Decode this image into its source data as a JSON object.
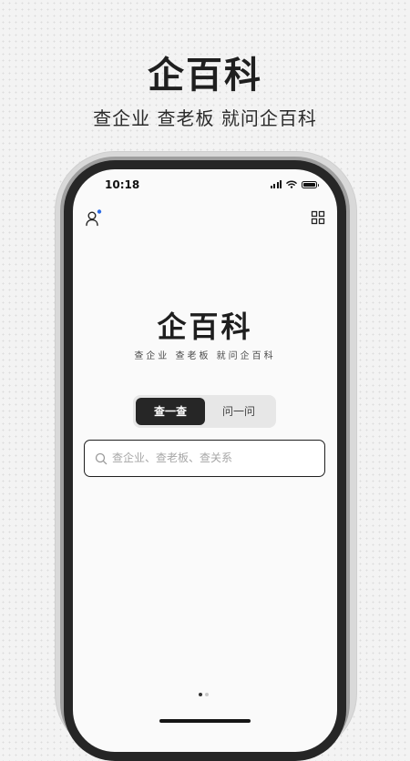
{
  "promo": {
    "title": "企百科",
    "subtitle": "查企业 查老板 就问企百科"
  },
  "status_bar": {
    "time": "10:18",
    "icons": [
      "signal-icon",
      "wifi-icon",
      "battery-icon"
    ]
  },
  "header": {
    "profile_icon": "user-icon",
    "notification_dot_color": "#2b6be6",
    "apps_icon": "grid-icon"
  },
  "app": {
    "title": "企百科",
    "slogan": "查企业 查老板 就问企百科"
  },
  "mode_toggle": {
    "tabs": [
      {
        "label": "查一查",
        "selected": true
      },
      {
        "label": "问一问",
        "selected": false
      }
    ]
  },
  "search": {
    "placeholder": "查企业、查老板、查关系",
    "value": ""
  },
  "pagination": {
    "current": 1,
    "total": 2
  },
  "colors": {
    "accent": "#262626",
    "background": "#f3f3f3",
    "screen": "#fafafa"
  }
}
